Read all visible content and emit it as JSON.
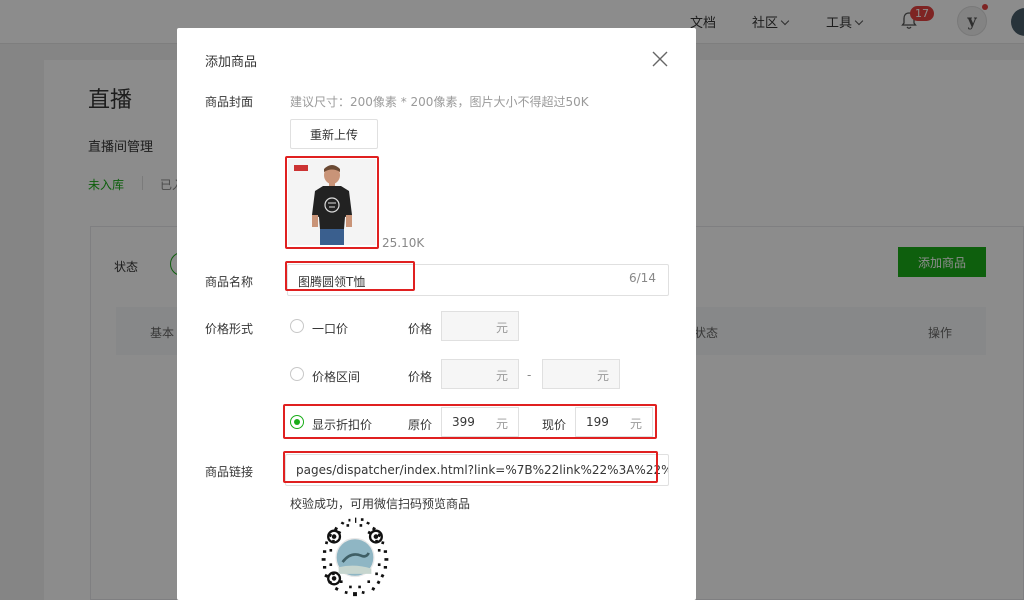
{
  "topbar": {
    "nav": [
      "文档",
      "社区",
      "工具"
    ],
    "notification_count": "17",
    "brand_letter": "y"
  },
  "page": {
    "title": "直播",
    "subtitle": "直播间管理",
    "tabs": [
      "未入库",
      "已入"
    ],
    "status_label": "状态",
    "add_button": "添加商品",
    "table_headers": [
      "基本",
      "状态",
      "操作"
    ]
  },
  "dialog": {
    "title": "添加商品",
    "cover": {
      "label": "商品封面",
      "hint": "建议尺寸：200像素 * 200像素，图片大小不得超过50K",
      "reupload_label": "重新上传",
      "file_size": "25.10K"
    },
    "name": {
      "label": "商品名称",
      "value": "图腾圆领T恤",
      "count": "6/14"
    },
    "price": {
      "label": "价格形式",
      "options": [
        {
          "label": "一口价",
          "selected": false
        },
        {
          "label": "价格区间",
          "selected": false
        },
        {
          "label": "显示折扣价",
          "selected": true
        }
      ],
      "price_label": "价格",
      "unit": "元",
      "range_separator": "-",
      "original_label": "原价",
      "original_value": "399",
      "current_label": "现价",
      "current_value": "199"
    },
    "link": {
      "label": "商品链接",
      "value": "pages/dispatcher/index.html?link=%7B%22link%22%3A%22%",
      "verify_text": "校验成功，可用微信扫码预览商品"
    }
  },
  "colors": {
    "primary_green": "#1aad19",
    "highlight_red": "#e02020",
    "badge_red": "#e64340"
  },
  "icons": {
    "close": "close-icon",
    "bell": "bell-icon",
    "chevron": "chevron-down-icon"
  }
}
